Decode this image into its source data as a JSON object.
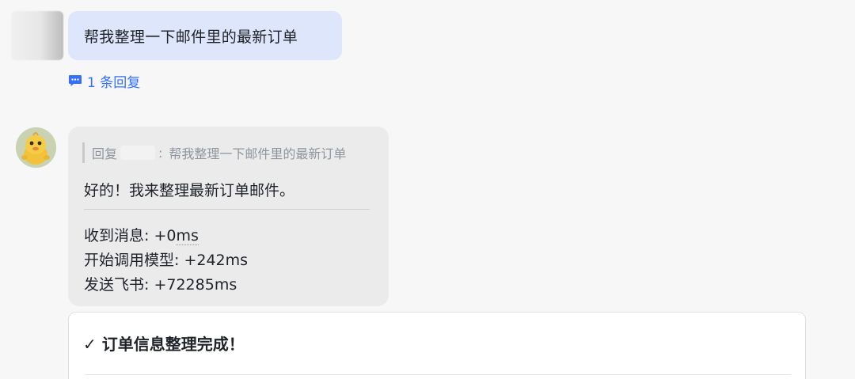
{
  "thread": {
    "user_message": {
      "text": "帮我整理一下邮件里的最新订单",
      "avatar_icon": "blurred-user-avatar"
    },
    "reply_count_label": "1 条回复",
    "bot_message": {
      "avatar_icon": "yellow-mascot-avatar",
      "quote": {
        "prefix": "回复",
        "colon": ":",
        "text": "帮我整理一下邮件里的最新订单"
      },
      "reply_text": "好的！我来整理最新订单邮件。",
      "timings": [
        {
          "label": "收到消息:",
          "value_prefix": "+0",
          "value_suffix": "ms"
        },
        {
          "label": "开始调用模型:",
          "value": "+242ms"
        },
        {
          "label": "发送飞书:",
          "value": "+72285ms"
        }
      ]
    },
    "card": {
      "check_icon": "✓",
      "title": "订单信息整理完成！"
    }
  },
  "colors": {
    "accent": "#3370ff",
    "user_bubble": "#dde6fb",
    "bot_bubble": "#ebebeb",
    "background": "#f7f7f7"
  }
}
